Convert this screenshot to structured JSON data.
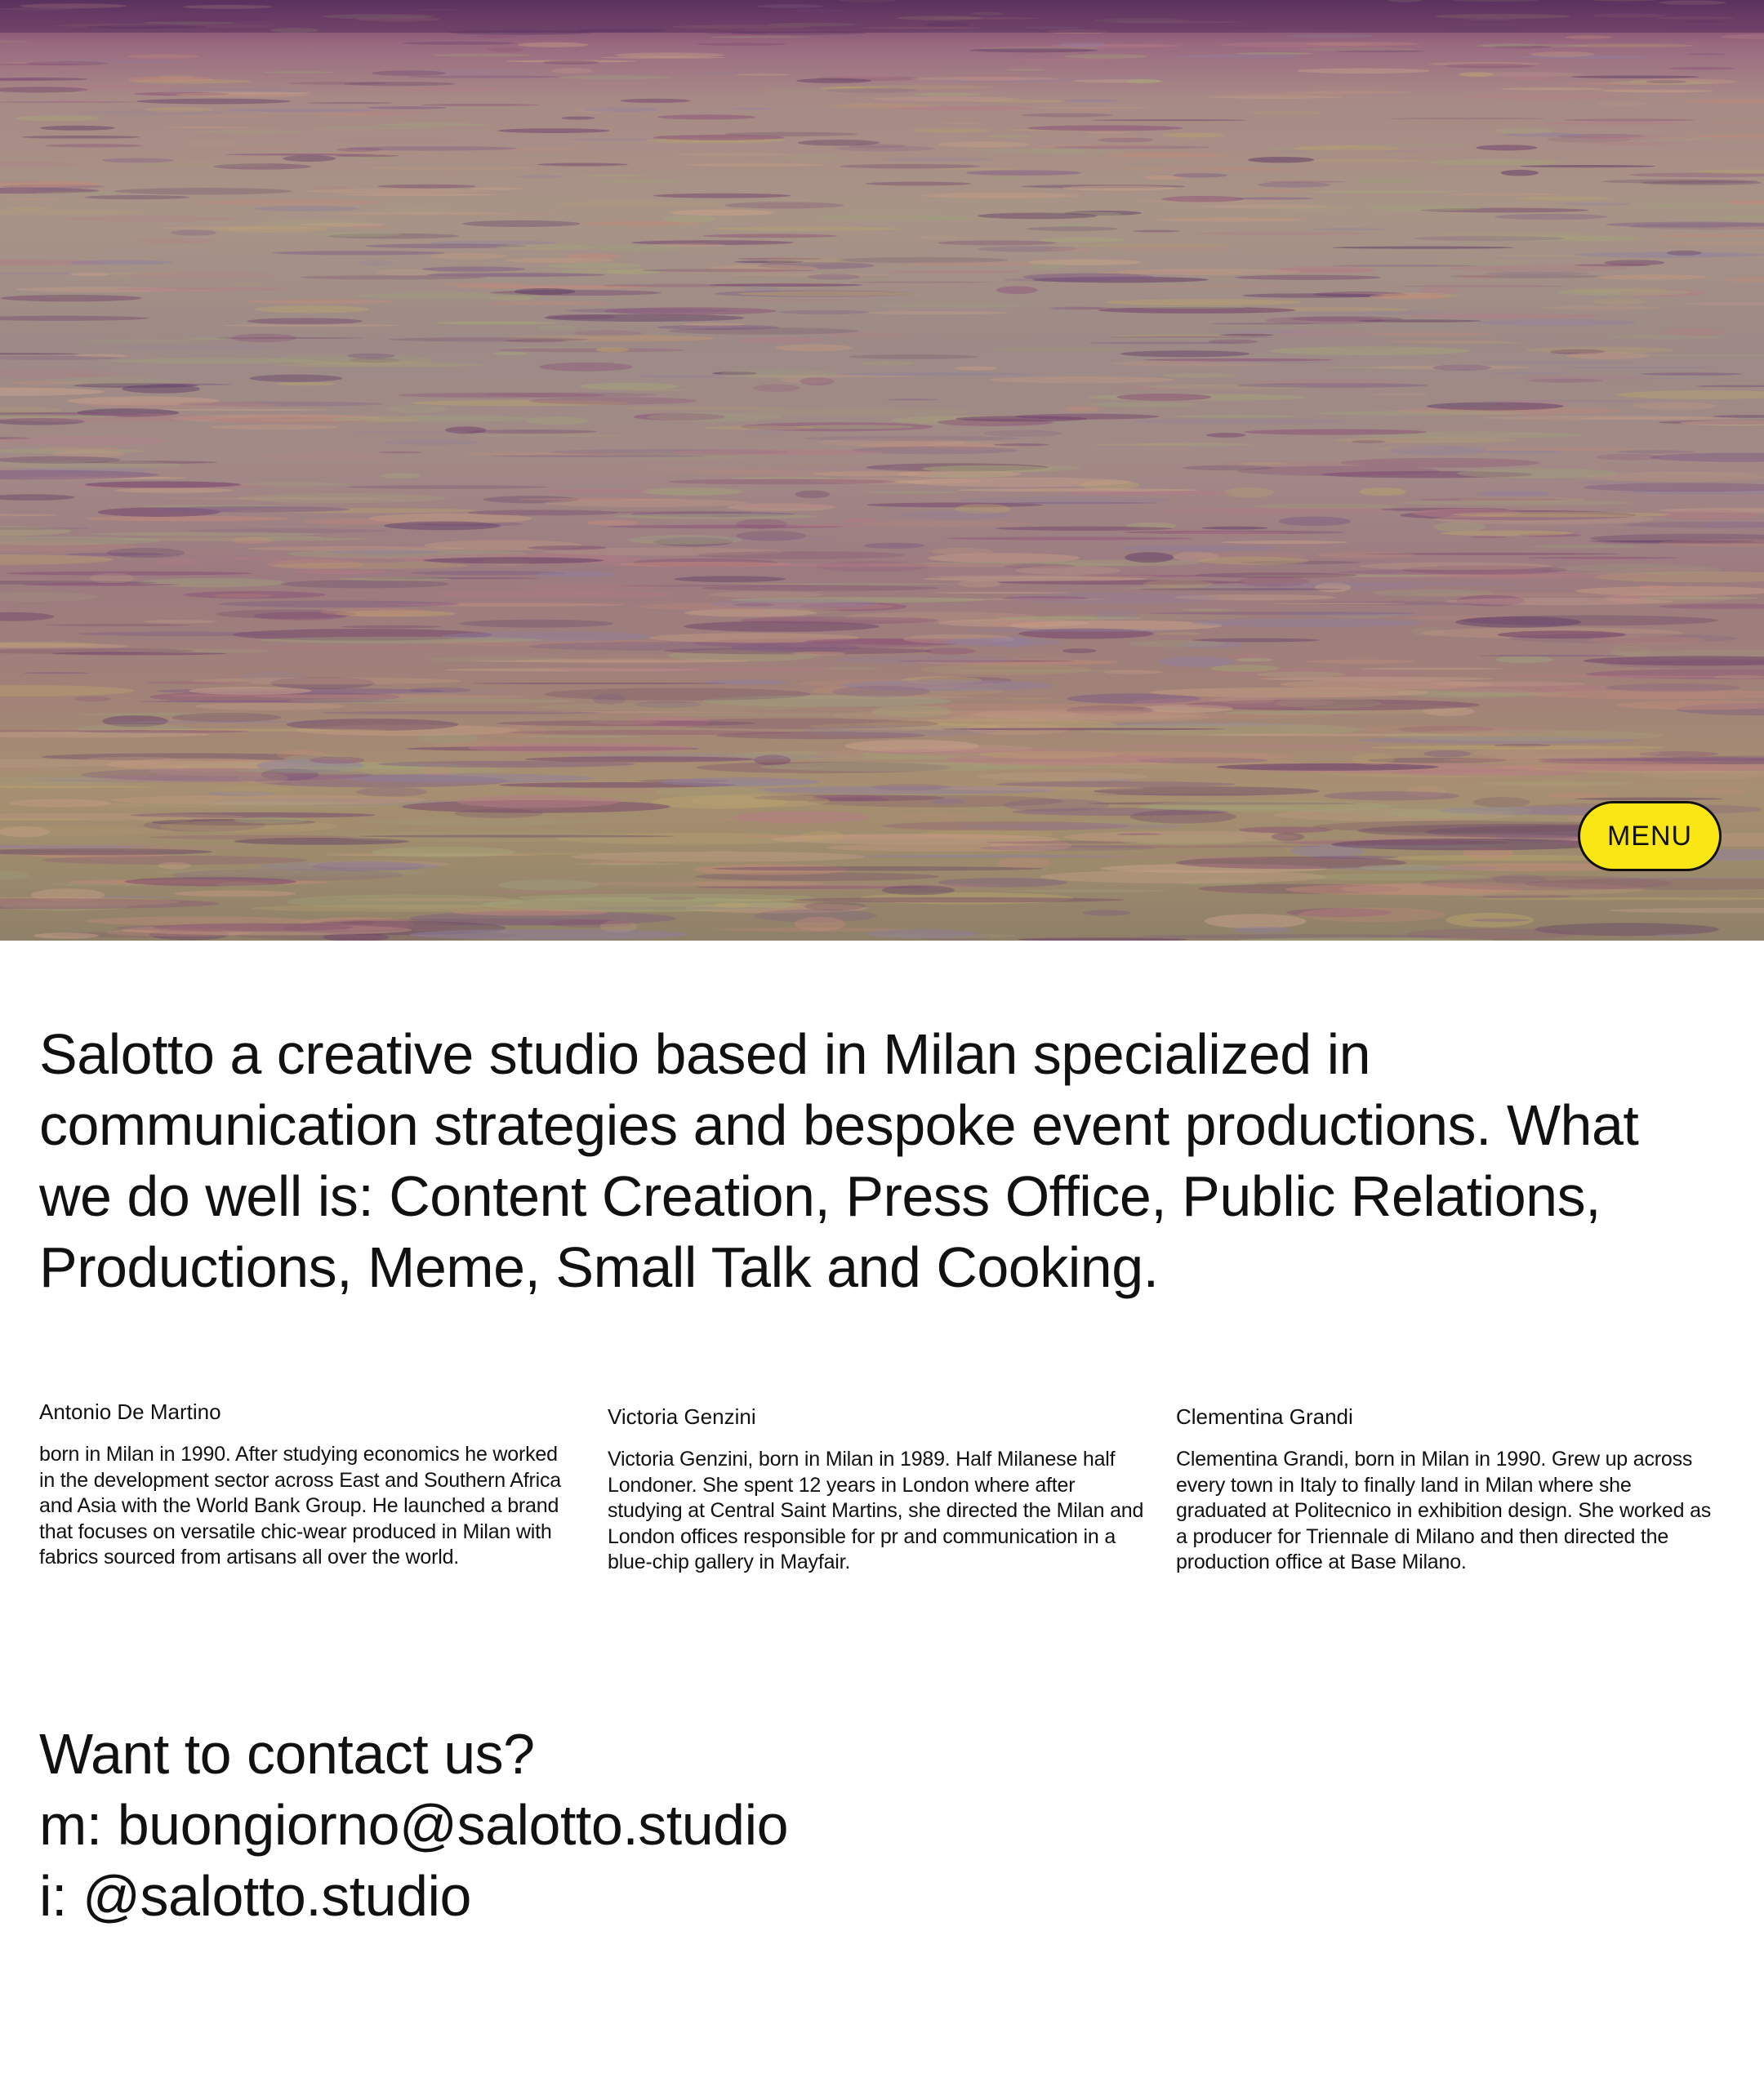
{
  "hero": {
    "menu_label": "MENU"
  },
  "intro": {
    "text": "Salotto a creative studio based in Milan specialized in communication strategies and bespoke event  productions. What we do well is: Content Creation, Press Office, Public Relations, Productions, Meme, Small Talk and Cooking."
  },
  "team": [
    {
      "name": "Antonio De Martino",
      "bio": "born in Milan in 1990. After studying economics he worked in the development sector across East and Southern Africa and Asia with the World Bank Group. He launched a brand that focuses on versatile chic-wear produced in Milan with fabrics sourced from artisans all over the world."
    },
    {
      "name": "Victoria Genzini",
      "bio": "Victoria Genzini, born in Milan  in 1989. Half Milanese half Londoner. She spent 12 years in London where after studying at Central Saint Martins, she directed the Milan and London offices  responsible for pr and communication in a blue-chip gallery in Mayfair."
    },
    {
      "name": "Clementina Grandi",
      "bio": "Clementina Grandi, born in Milan in 1990. Grew up across every town in Italy to finally land in Milan where she graduated at Politecnico in exhibition design. She worked as a producer for Triennale di Milano and then directed the production office at Base Milano."
    }
  ],
  "contact": {
    "heading": "Want to contact us?",
    "email_line": "m: buongiorno@salotto.studio",
    "instagram_line": "i: @salotto.studio"
  },
  "colors": {
    "menu_background": "#fbe615",
    "text": "#111111",
    "page_background": "#ffffff"
  }
}
